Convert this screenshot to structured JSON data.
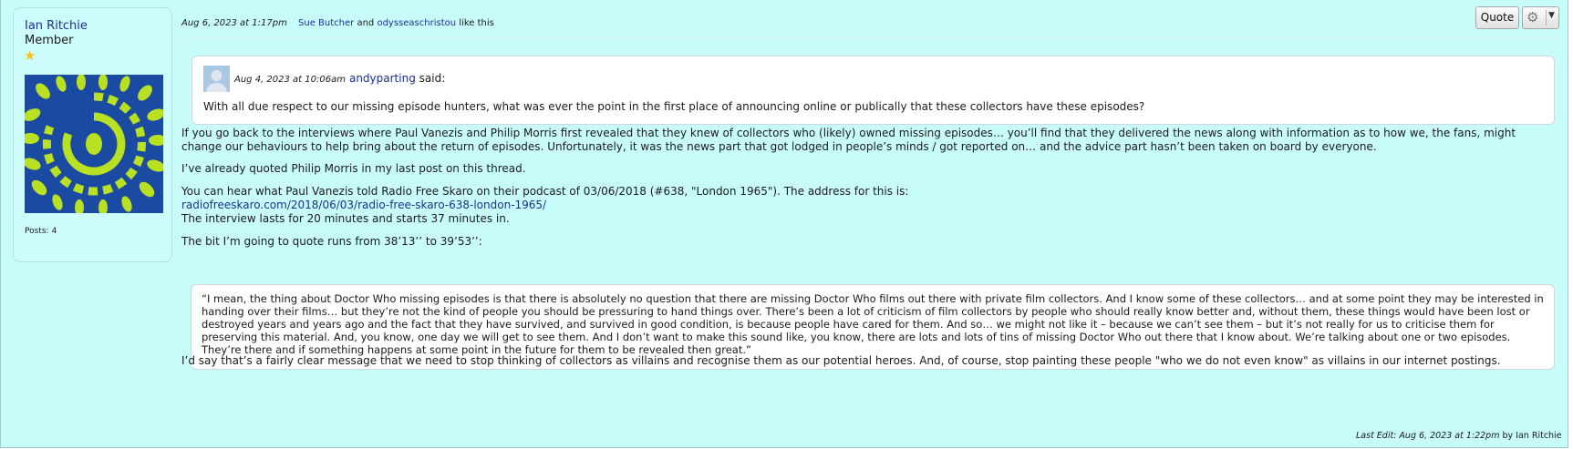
{
  "author": {
    "name": "Ian Ritchie",
    "role": "Member",
    "rank_icon": "star-icon",
    "posts_label": "Posts:",
    "posts_count": "4"
  },
  "post": {
    "timestamp": "Aug 6, 2023 at 1:17pm",
    "liked_users": "Sue Butcher",
    "liked_conj": "and",
    "liked_users2": "odysseaschristou",
    "liked_suffix": "like this"
  },
  "toolbar": {
    "quote_label": "Quote",
    "gear_icon": "gear-icon",
    "caret_icon": "caret-down-icon"
  },
  "quote": {
    "timestamp": "Aug 4, 2023 at 10:06am",
    "author": "andyparting",
    "said": "said:",
    "text": "With all due respect to our missing episode hunters, what was ever the point in the first place of announcing online or publically that these collectors have these episodes?"
  },
  "body": {
    "p1": "If you go back to the interviews where Paul Vanezis and Philip Morris first revealed that they knew of collectors who (likely) owned missing episodes… you’ll find that they delivered the news along with information as to how we, the fans, might change our behaviours to help bring about the return of episodes. Unfortunately, it was the news part that got lodged in people’s minds / got reported on… and the advice part hasn’t been taken on board by everyone.",
    "p2": "I’ve already quoted Philip Morris in my last post on this thread.",
    "p3": "You can hear what Paul Vanezis told Radio Free Skaro on their podcast of 03/06/2018 (#638, \"London 1965\"). The address for this is:",
    "link": "radiofreeskaro.com/2018/06/03/radio-free-skaro-638-london-1965/",
    "p4": "The interview lasts for 20 minutes and starts 37 minutes in.",
    "p5": "The bit I’m going to quote runs from 38’13’’ to 39’53’’:",
    "blockquote": "“I mean, the thing about Doctor Who missing episodes is that there is absolutely no question that there are missing Doctor Who films out there with private film collectors. And I know some of these collectors… and at some point they may be interested in handing over their films… but they’re not the kind of people you should be pressuring to hand things over. There’s been a lot of criticism of film collectors by people who should really know better and, without them, these things would have been lost or destroyed years and years ago and the fact that they have survived, and survived in good condition, is because people have cared for them. And so… we might not like it – because we can’t see them – but it’s not really for us to criticise them for preserving this material. And, you know, one day we will get to see them. And I don’t want to make this sound like, you know, there are lots and lots of tins of missing Doctor Who out there that I know about. We’re talking about one or two episodes. They’re there and if something happens at some point in the future for them to be revealed then great.”",
    "p6": "I’d say that’s a fairly clear message that we need to stop thinking of collectors as villains and recognise them as our potential heroes. And, of course, stop painting these people \"who we do not even know\" as villains in our internet postings."
  },
  "last_edit": {
    "label": "Last Edit: Aug 6, 2023 at 1:22pm",
    "by": "by",
    "user": "Ian Ritchie"
  }
}
